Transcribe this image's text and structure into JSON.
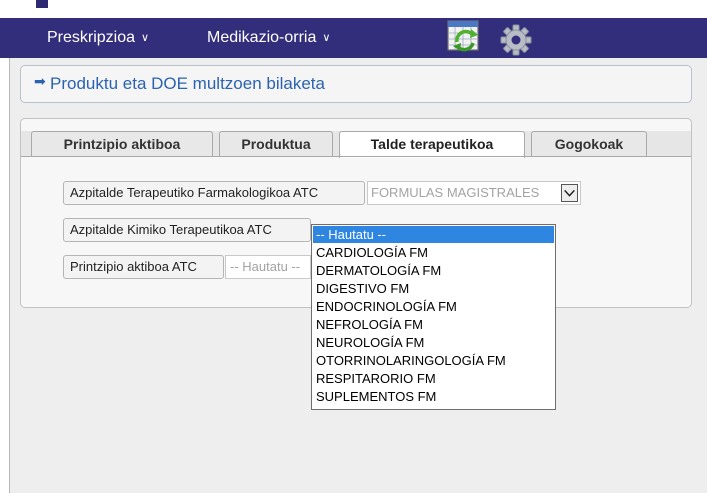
{
  "nav": {
    "menus": [
      {
        "label": "Preskripzioa",
        "chevron": "∨"
      },
      {
        "label": "Medikazio-orria",
        "chevron": "∨"
      }
    ],
    "icons": [
      "calendar-refresh-icon",
      "gear-icon"
    ]
  },
  "page": {
    "title": "Produktu eta DOE multzoen bilaketa"
  },
  "tabs": [
    {
      "label": "Printzipio aktiboa",
      "active": false
    },
    {
      "label": "Produktua",
      "active": false
    },
    {
      "label": "Talde terapeutikoa",
      "active": true
    },
    {
      "label": "Gogokoak",
      "active": false
    }
  ],
  "fields": [
    {
      "label": "Azpitalde Terapeutiko Farmakologikoa ATC",
      "value": "FORMULAS MAGISTRALES"
    },
    {
      "label": "Azpitalde Kimiko Terapeutikoa ATC",
      "value": "-- Hautatu --"
    },
    {
      "label": "Printzipio aktiboa ATC",
      "value": "-- Hautatu --"
    }
  ],
  "dropdown": {
    "options": [
      "-- Hautatu --",
      "CARDIOLOGÍA FM",
      "DERMATOLOGÍA FM",
      "DIGESTIVO FM",
      "ENDOCRINOLOGÍA FM",
      "NEFROLOGÍA FM",
      "NEUROLOGÍA FM",
      "OTORRINOLARINGOLOGÍA FM",
      "RESPITARORIO FM",
      "SUPLEMENTOS FM"
    ],
    "selected_index": 0
  },
  "colors": {
    "nav_bg": "#332e7b",
    "title_blue": "#2b63b0",
    "selection_blue": "#2f86e0"
  }
}
